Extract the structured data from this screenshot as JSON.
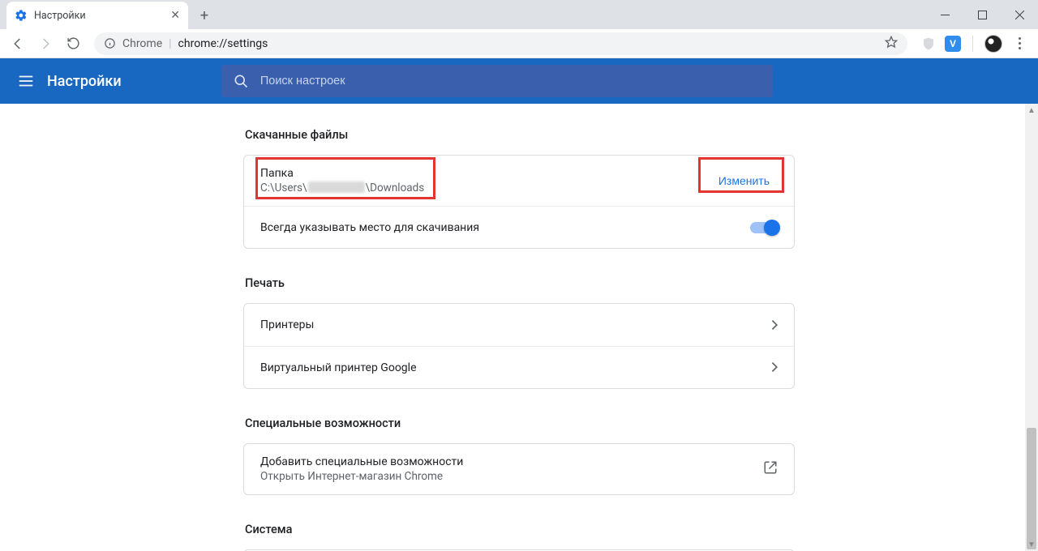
{
  "tab": {
    "title": "Настройки"
  },
  "omnibox": {
    "origin": "Chrome",
    "path": "chrome://settings"
  },
  "ext": {
    "v_label": "V"
  },
  "settings": {
    "app_title": "Настройки",
    "search_placeholder": "Поиск настроек"
  },
  "downloads": {
    "section": "Скачанные файлы",
    "folder_label": "Папка",
    "folder_path_prefix": "C:\\Users\\",
    "folder_path_suffix": "\\Downloads",
    "change": "Изменить",
    "ask_where": "Всегда указывать место для скачивания",
    "ask_where_on": true
  },
  "printing": {
    "section": "Печать",
    "printers": "Принтеры",
    "cloud_print": "Виртуальный принтер Google"
  },
  "a11y": {
    "section": "Специальные возможности",
    "add_title": "Добавить специальные возможности",
    "add_sub": "Открыть Интернет-магазин Chrome"
  },
  "system": {
    "section": "Система"
  }
}
